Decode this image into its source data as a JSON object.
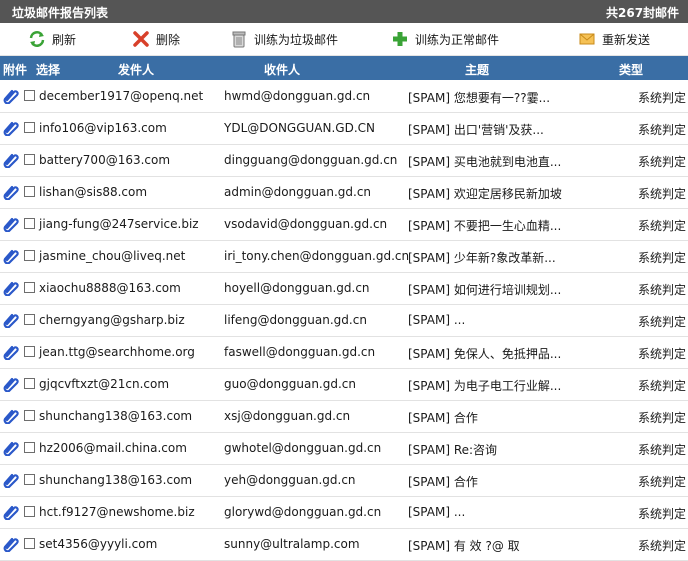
{
  "title": "垃圾邮件报告列表",
  "count_text": "共267封邮件",
  "toolbar": {
    "refresh": "刷新",
    "delete": "删除",
    "train_spam": "训练为垃圾邮件",
    "train_normal": "训练为正常邮件",
    "resend": "重新发送"
  },
  "columns": {
    "attach": "附件",
    "select": "选择",
    "sender": "发件人",
    "recipient": "收件人",
    "subject": "主题",
    "type": "类型"
  },
  "rows": [
    {
      "sender": "december1917@openq.net",
      "recipient": "hwmd@dongguan.gd.cn",
      "subject": "[SPAM] 您想要有一??霎...",
      "type": "系统判定"
    },
    {
      "sender": "info106@vip163.com",
      "recipient": "YDL@DONGGUAN.GD.CN",
      "subject": "[SPAM] 出口'营销'及获...",
      "type": "系统判定"
    },
    {
      "sender": "battery700@163.com",
      "recipient": "dingguang@dongguan.gd.cn",
      "subject": "[SPAM] 买电池就到电池直...",
      "type": "系统判定"
    },
    {
      "sender": "lishan@sis88.com",
      "recipient": "admin@dongguan.gd.cn",
      "subject": "[SPAM] 欢迎定居移民新加坡",
      "type": "系统判定"
    },
    {
      "sender": "jiang-fung@247service.biz",
      "recipient": "vsodavid@dongguan.gd.cn",
      "subject": "[SPAM] 不要把一生心血精...",
      "type": "系统判定"
    },
    {
      "sender": "jasmine_chou@liveq.net",
      "recipient": "iri_tony.chen@dongguan.gd.cn",
      "subject": "[SPAM] 少年新?象改革新...",
      "type": "系统判定"
    },
    {
      "sender": "xiaochu8888@163.com",
      "recipient": "hoyell@dongguan.gd.cn",
      "subject": "[SPAM] 如何进行培训规划...",
      "type": "系统判定"
    },
    {
      "sender": "cherngyang@gsharp.biz",
      "recipient": "lifeng@dongguan.gd.cn",
      "subject": "[SPAM]  ...",
      "type": "系统判定"
    },
    {
      "sender": "jean.ttg@searchhome.org",
      "recipient": "faswell@dongguan.gd.cn",
      "subject": "[SPAM] 免保人、免抵押品...",
      "type": "系统判定"
    },
    {
      "sender": "gjqcvftxzt@21cn.com",
      "recipient": "guo@dongguan.gd.cn",
      "subject": "[SPAM] 为电子电工行业解...",
      "type": "系统判定"
    },
    {
      "sender": "shunchang138@163.com",
      "recipient": "xsj@dongguan.gd.cn",
      "subject": "[SPAM] 合作",
      "type": "系统判定"
    },
    {
      "sender": "hz2006@mail.china.com",
      "recipient": "gwhotel@dongguan.gd.cn",
      "subject": "[SPAM] Re:咨询",
      "type": "系统判定"
    },
    {
      "sender": "shunchang138@163.com",
      "recipient": "yeh@dongguan.gd.cn",
      "subject": "[SPAM] 合作",
      "type": "系统判定"
    },
    {
      "sender": "hct.f9127@newshome.biz",
      "recipient": "glorywd@dongguan.gd.cn",
      "subject": "[SPAM]  ...",
      "type": "系统判定"
    },
    {
      "sender": "set4356@yyyli.com",
      "recipient": "sunny@ultralamp.com",
      "subject": "[SPAM] 有 效 ?@ 取",
      "type": "系统判定"
    }
  ]
}
